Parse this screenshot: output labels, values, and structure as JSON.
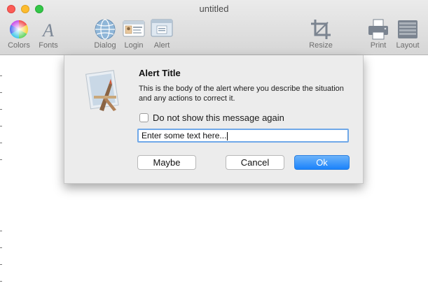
{
  "window": {
    "title": "untitled"
  },
  "toolbar": {
    "items": [
      {
        "label": "Colors",
        "icon": "color-wheel-icon"
      },
      {
        "label": "Fonts",
        "icon": "font-icon"
      },
      {
        "label": "Dialog",
        "icon": "globe-icon"
      },
      {
        "label": "Login",
        "icon": "id-card-icon"
      },
      {
        "label": "Alert",
        "icon": "alert-icon"
      },
      {
        "label": "Resize",
        "icon": "crop-icon"
      },
      {
        "label": "Print",
        "icon": "printer-icon"
      },
      {
        "label": "Layout",
        "icon": "layout-icon"
      }
    ]
  },
  "alert": {
    "title": "Alert Title",
    "body": "This is the body of the alert where you describe the situation and any actions to correct it.",
    "checkbox_label": "Do not show this message again",
    "text_value": "Enter some text here...",
    "buttons": {
      "maybe": "Maybe",
      "cancel": "Cancel",
      "ok": "Ok"
    },
    "accent_color": "#1a82fb"
  }
}
